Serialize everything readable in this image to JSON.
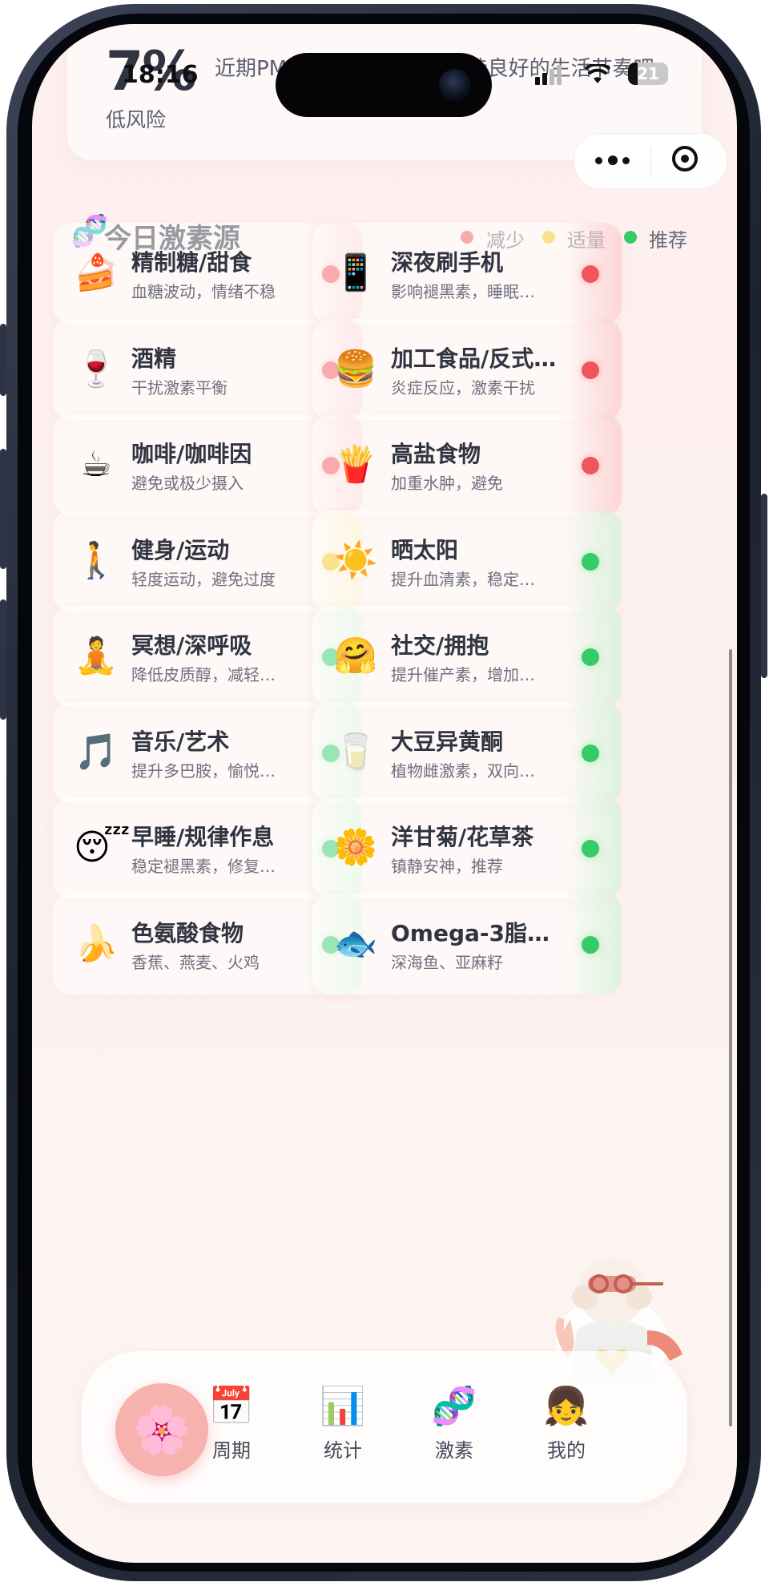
{
  "status": {
    "time": "18:16",
    "battery": "21"
  },
  "risk": {
    "percent": "7%",
    "level": "低风险",
    "message": "近期PMS风险较低，继续保持良好的生活节奏吧"
  },
  "section": {
    "title": "今日激素源",
    "icon": "🧬"
  },
  "legend": [
    {
      "label": "减少",
      "color": "#f0555e"
    },
    {
      "label": "适量",
      "color": "#f5c518"
    },
    {
      "label": "推荐",
      "color": "#35cc66"
    }
  ],
  "items": [
    {
      "emoji": "🍰",
      "title": "精制糖/甜食",
      "desc": "血糖波动，情绪不稳",
      "level": "减少"
    },
    {
      "emoji": "📱",
      "title": "深夜刷手机",
      "desc": "影响褪黑素，睡眠…",
      "level": "减少"
    },
    {
      "emoji": "🍷",
      "title": "酒精",
      "desc": "干扰激素平衡",
      "level": "减少"
    },
    {
      "emoji": "🍔",
      "title": "加工食品/反式…",
      "desc": "炎症反应，激素干扰",
      "level": "减少"
    },
    {
      "emoji": "☕",
      "title": "咖啡/咖啡因",
      "desc": "避免或极少摄入",
      "level": "减少"
    },
    {
      "emoji": "🍟",
      "title": "高盐食物",
      "desc": "加重水肿，避免",
      "level": "减少"
    },
    {
      "emoji": "🚶",
      "title": "健身/运动",
      "desc": "轻度运动，避免过度",
      "level": "适量"
    },
    {
      "emoji": "☀️",
      "title": "晒太阳",
      "desc": "提升血清素，稳定…",
      "level": "推荐"
    },
    {
      "emoji": "🧘",
      "title": "冥想/深呼吸",
      "desc": "降低皮质醇，减轻…",
      "level": "推荐"
    },
    {
      "emoji": "🤗",
      "title": "社交/拥抱",
      "desc": "提升催产素，增加…",
      "level": "推荐"
    },
    {
      "emoji": "🎵",
      "title": "音乐/艺术",
      "desc": "提升多巴胺，愉悦…",
      "level": "推荐"
    },
    {
      "emoji": "🥛",
      "title": "大豆异黄酮",
      "desc": "植物雌激素，双向…",
      "level": "推荐"
    },
    {
      "emoji": "😴",
      "title": "早睡/规律作息",
      "desc": "稳定褪黑素，修复…",
      "level": "推荐"
    },
    {
      "emoji": "🌼",
      "title": "洋甘菊/花草茶",
      "desc": "镇静安神，推荐",
      "level": "推荐"
    },
    {
      "emoji": "🍌",
      "title": "色氨酸食物",
      "desc": "香蕉、燕麦、火鸡",
      "level": "推荐"
    },
    {
      "emoji": "🐟",
      "title": "Omega-3脂…",
      "desc": "深海鱼、亚麻籽",
      "level": "推荐"
    }
  ],
  "tabs": [
    {
      "icon": "📅",
      "label": "周期"
    },
    {
      "icon": "📊",
      "label": "统计"
    },
    {
      "icon": "🧬",
      "label": "激素"
    },
    {
      "icon": "👧",
      "label": "我的"
    }
  ],
  "home_icon": "🌸"
}
